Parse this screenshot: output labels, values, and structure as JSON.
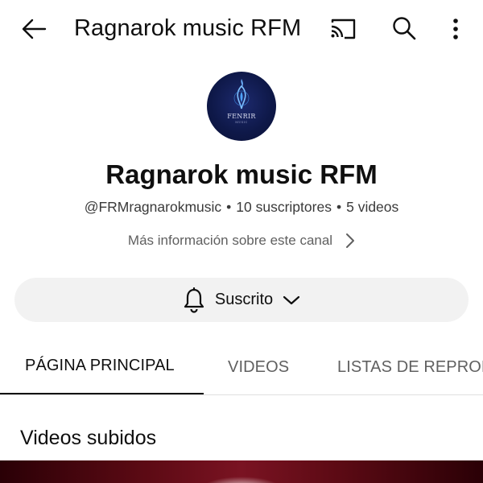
{
  "header": {
    "title": "Ragnarok music RFM",
    "back_icon": "arrow-left-icon",
    "cast_icon": "cast-icon",
    "search_icon": "search-icon",
    "more_icon": "more-vert-icon"
  },
  "channel": {
    "avatar_text": "FENRIR",
    "avatar_subtext": "MUSIC",
    "name": "Ragnarok music RFM",
    "handle": "@FRMragnarokmusic",
    "subscribers": "10 suscriptores",
    "videos": "5 videos",
    "separator": "•",
    "more_info": "Más información sobre este canal"
  },
  "subscribe": {
    "label": "Suscrito",
    "bell_icon": "bell-icon",
    "chevron_icon": "chevron-down-icon"
  },
  "tabs": [
    {
      "label": "PÁGINA PRINCIPAL",
      "active": true
    },
    {
      "label": "VIDEOS",
      "active": false
    },
    {
      "label": "LISTAS DE REPRODUCCIÓN",
      "active": false
    }
  ],
  "section": {
    "title": "Videos subidos"
  },
  "colors": {
    "text_primary": "#0f0f0f",
    "text_secondary": "#606060",
    "button_bg": "#f2f2f2",
    "avatar_bg": "#0e1848",
    "thumb_red": "#7a1322"
  }
}
